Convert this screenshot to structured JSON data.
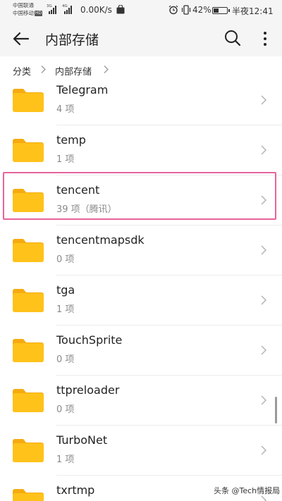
{
  "status_bar": {
    "carrier_1": "中国联通",
    "carrier_2": "中国移动",
    "hd_badge": "HD",
    "net_type_1": "3G",
    "net_type_2": "4G",
    "net_speed": "0.00K/s",
    "battery_percent": "42%",
    "battery_level": 0.42,
    "time": "半夜12:41",
    "icons": [
      "signal-icon",
      "shopping-bag-icon",
      "alarm-icon",
      "vibrate-icon",
      "battery-icon"
    ]
  },
  "app_bar": {
    "title": "内部存储",
    "icons": [
      "back-arrow-icon",
      "search-icon",
      "more-vertical-icon"
    ]
  },
  "breadcrumb": {
    "items": [
      "分类",
      "内部存储"
    ]
  },
  "files": [
    {
      "name": "Telegram",
      "count": "4 项"
    },
    {
      "name": "temp",
      "count": "1 项"
    },
    {
      "name": "tencent",
      "count": "39 项（腾讯）",
      "highlighted": true
    },
    {
      "name": "tencentmapsdk",
      "count": "0 项"
    },
    {
      "name": "tga",
      "count": "1 项"
    },
    {
      "name": "TouchSprite",
      "count": "0 项"
    },
    {
      "name": "ttpreloader",
      "count": "0 项"
    },
    {
      "name": "TurboNet",
      "count": "1 项"
    },
    {
      "name": "txrtmp",
      "count": ""
    }
  ],
  "watermark": "头条 @Tech情报局",
  "colors": {
    "folder": "#ffc21a",
    "folder_tab": "#f5ab10",
    "highlight_border": "#e6649a",
    "app_bar_bg": "#f5f5f5"
  }
}
